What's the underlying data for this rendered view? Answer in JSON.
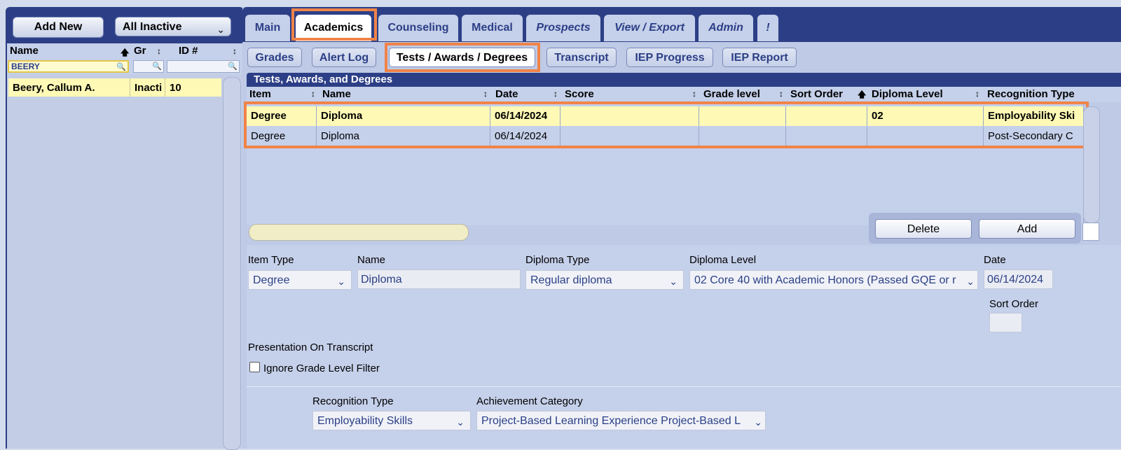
{
  "left": {
    "add_new_label": "Add New",
    "filter_select": "All Inactive",
    "columns": [
      "Name",
      "Gr",
      "ID #"
    ],
    "name_filter_value": "BEERY",
    "students": [
      {
        "name": "Beery, Callum A.",
        "grade": "Inacti",
        "id": "10"
      }
    ]
  },
  "tabs": [
    "Main",
    "Academics",
    "Counseling",
    "Medical",
    "Prospects",
    "View / Export",
    "Admin",
    "!"
  ],
  "active_tab": "Academics",
  "subtabs": [
    "Grades",
    "Alert Log",
    "Tests / Awards / Degrees",
    "Transcript",
    "IEP Progress",
    "IEP Report"
  ],
  "active_subtab": "Tests / Awards / Degrees",
  "grid": {
    "title": "Tests, Awards, and Degrees",
    "columns": [
      "Item",
      "Name",
      "Date",
      "Score",
      "Grade level",
      "Sort Order",
      "Diploma Level",
      "Recognition Type"
    ],
    "rows": [
      {
        "item": "Degree",
        "name": "Diploma",
        "date": "06/14/2024",
        "score": "",
        "grade_level": "",
        "sort_order": "",
        "diploma_level": "02",
        "recognition_type": "Employability Ski"
      },
      {
        "item": "Degree",
        "name": "Diploma",
        "date": "06/14/2024",
        "score": "",
        "grade_level": "",
        "sort_order": "",
        "diploma_level": "",
        "recognition_type": "Post-Secondary C"
      }
    ],
    "delete_label": "Delete",
    "add_label": "Add"
  },
  "form": {
    "item_type_label": "Item Type",
    "item_type_value": "Degree",
    "name_label": "Name",
    "name_value": "Diploma",
    "diploma_type_label": "Diploma Type",
    "diploma_type_value": "Regular diploma",
    "diploma_level_label": "Diploma Level",
    "diploma_level_value": "02 Core 40 with Academic Honors (Passed GQE or r",
    "date_label": "Date",
    "date_value": "06/14/2024",
    "sort_order_label": "Sort Order",
    "sort_order_value": "",
    "presentation_label": "Presentation On Transcript",
    "ignore_filter_label": "Ignore Grade Level Filter",
    "ignore_filter_checked": false,
    "recognition_type_label": "Recognition Type",
    "recognition_type_value": "Employability Skills",
    "achievement_category_label": "Achievement Category",
    "achievement_category_value": "Project-Based Learning Experience Project-Based L"
  },
  "colors": {
    "nav": "#2c3f86",
    "highlight": "#f08449",
    "selected_row": "#fff9b6"
  }
}
